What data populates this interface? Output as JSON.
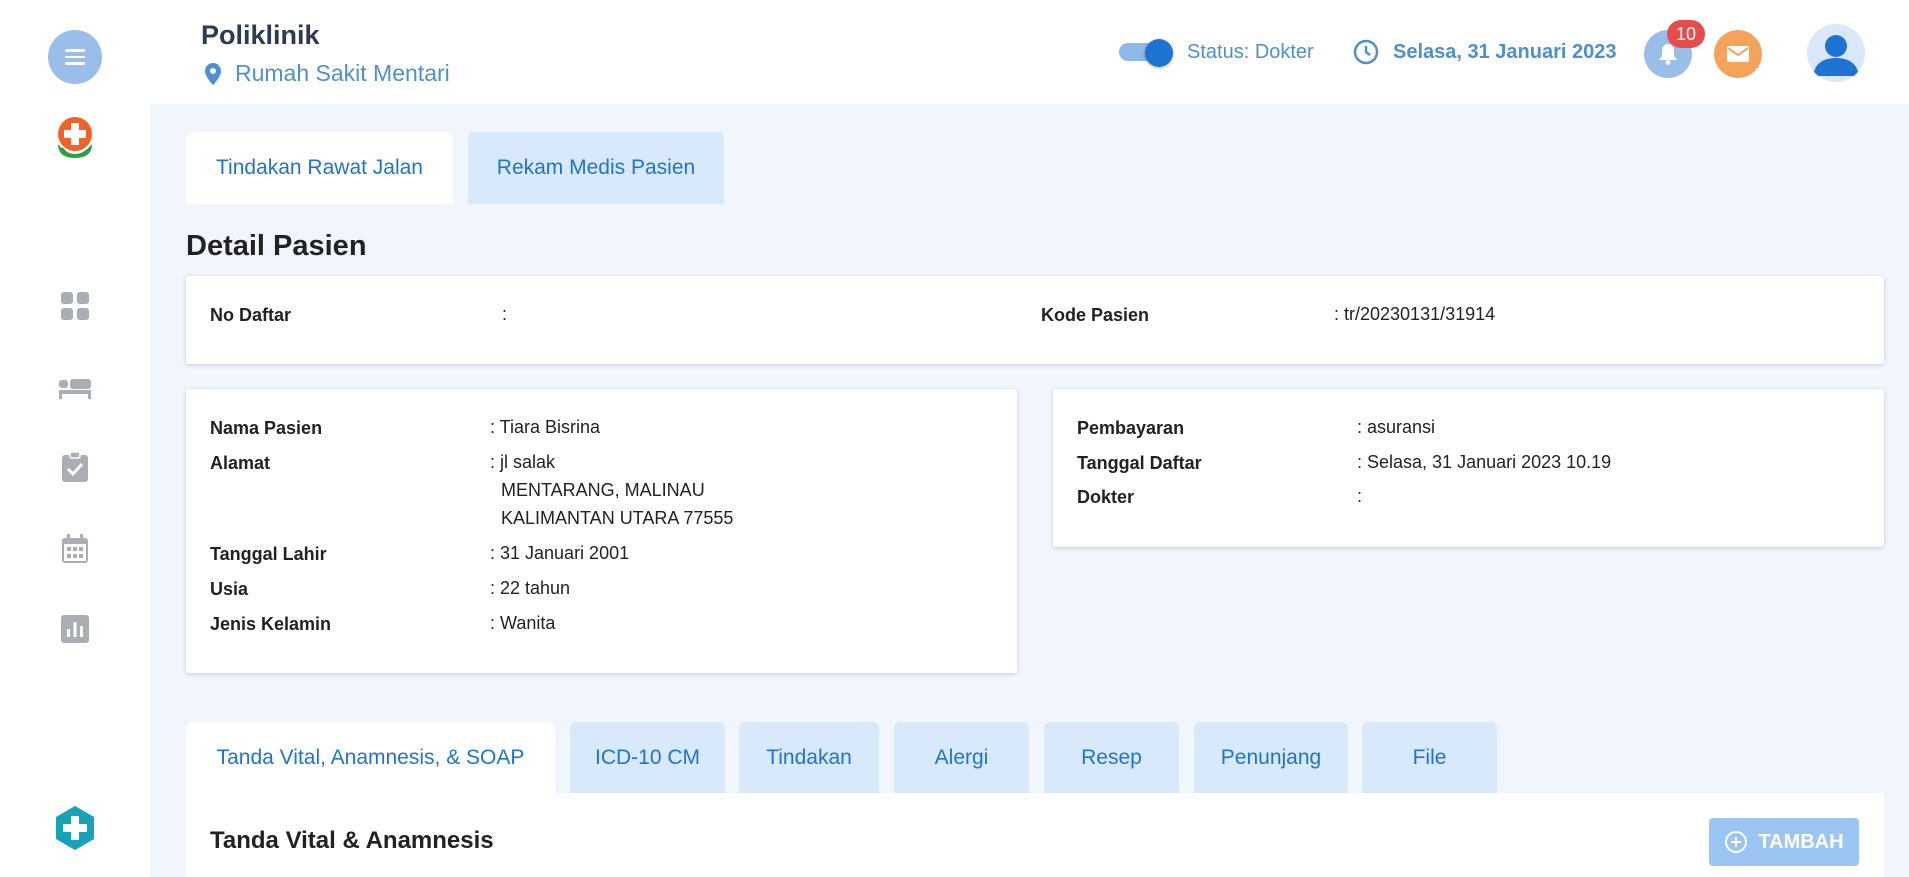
{
  "header": {
    "title": "Poliklinik",
    "location": "Rumah Sakit Mentari",
    "status": "Status: Dokter",
    "date": "Selasa, 31 Januari 2023",
    "notification_count": "10"
  },
  "top_tabs": [
    {
      "label": "Tindakan Rawat Jalan",
      "active": true
    },
    {
      "label": "Rekam Medis Pasien",
      "active": false
    }
  ],
  "detail": {
    "title": "Detail Pasien",
    "no_daftar_label": "No Daftar",
    "no_daftar_value": ":",
    "kode_pasien_label": "Kode Pasien",
    "kode_pasien_value": ": tr/20230131/31914"
  },
  "patient": {
    "nama_label": "Nama Pasien",
    "nama_value": ": Tiara Bisrina",
    "alamat_label": "Alamat",
    "alamat_line1": ": jl salak",
    "alamat_line2": "MENTARANG, MALINAU",
    "alamat_line3": "KALIMANTAN UTARA 77555",
    "lahir_label": "Tanggal Lahir",
    "lahir_value": ": 31 Januari 2001",
    "usia_label": "Usia",
    "usia_value": ": 22 tahun",
    "kelamin_label": "Jenis Kelamin",
    "kelamin_value": ": Wanita"
  },
  "registration": {
    "pembayaran_label": "Pembayaran",
    "pembayaran_value": ": asuransi",
    "tanggal_label": "Tanggal Daftar",
    "tanggal_value": ": Selasa, 31 Januari 2023 10.19",
    "dokter_label": "Dokter",
    "dokter_value": ":"
  },
  "bottom_tabs": [
    {
      "label": "Tanda Vital, Anamnesis, & SOAP",
      "active": true
    },
    {
      "label": "ICD-10 CM",
      "active": false
    },
    {
      "label": "Tindakan",
      "active": false
    },
    {
      "label": "Alergi",
      "active": false
    },
    {
      "label": "Resep",
      "active": false
    },
    {
      "label": "Penunjang",
      "active": false
    },
    {
      "label": "File",
      "active": false
    }
  ],
  "vital": {
    "title": "Tanda Vital & Anamnesis",
    "add_label": "TAMBAH"
  },
  "icons": {
    "menu": "menu-icon",
    "logo": "hospital-logo",
    "location": "location-pin-icon",
    "clock": "clock-icon",
    "bell": "bell-icon",
    "mail": "mail-icon",
    "avatar": "user-avatar-icon",
    "nav": [
      "dashboard-icon",
      "bed-icon",
      "clipboard-check-icon",
      "calendar-icon",
      "chart-icon"
    ],
    "add": "plus-circle-icon"
  },
  "colors": {
    "primary": "#1f73d2",
    "accent_light": "#9bbde9",
    "badge": "#e74c4c",
    "mail": "#f5a35b",
    "background": "#f1f6fd"
  }
}
